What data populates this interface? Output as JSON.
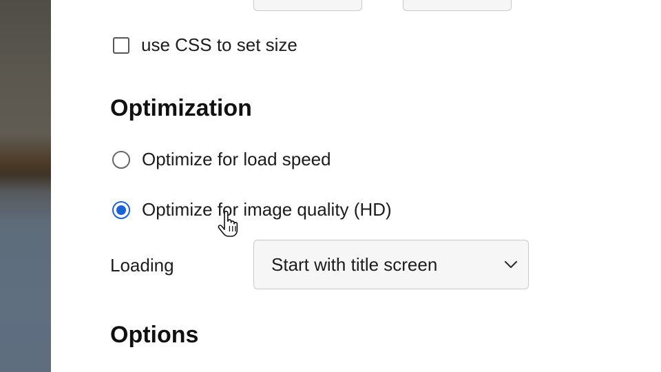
{
  "size": {
    "css_checkbox_label": "use CSS to set size"
  },
  "optimization": {
    "heading": "Optimization",
    "options": [
      {
        "label": "Optimize for load speed",
        "selected": false
      },
      {
        "label": "Optimize for image quality (HD)",
        "selected": true
      }
    ],
    "loading_label": "Loading",
    "loading_value": "Start with title screen"
  },
  "options_section": {
    "heading": "Options"
  },
  "icons": {
    "dropdown": "chevron-down-icon",
    "cursor": "hand-pointer-icon"
  },
  "colors": {
    "accent": "#1a63d6"
  }
}
